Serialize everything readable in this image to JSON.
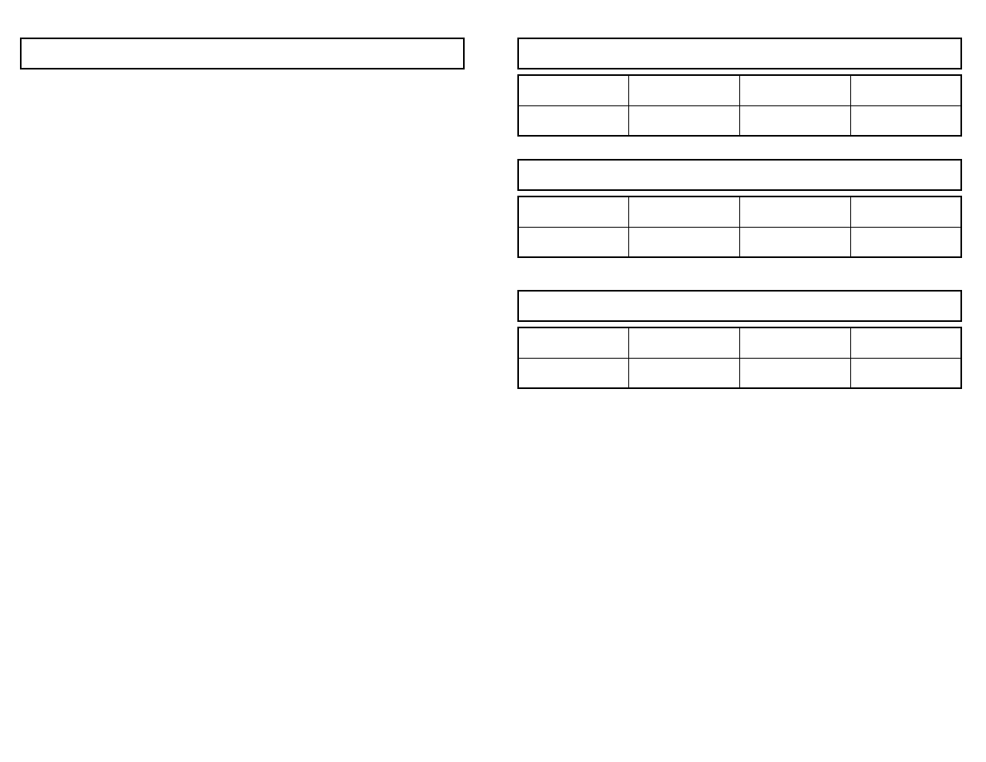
{
  "left_box": {
    "text": ""
  },
  "tables": [
    {
      "header": "",
      "rows": [
        [
          "",
          "",
          "",
          ""
        ],
        [
          "",
          "",
          "",
          ""
        ]
      ]
    },
    {
      "header": "",
      "rows": [
        [
          "",
          "",
          "",
          ""
        ],
        [
          "",
          "",
          "",
          ""
        ]
      ]
    },
    {
      "header": "",
      "rows": [
        [
          "",
          "",
          "",
          ""
        ],
        [
          "",
          "",
          "",
          ""
        ]
      ]
    }
  ]
}
